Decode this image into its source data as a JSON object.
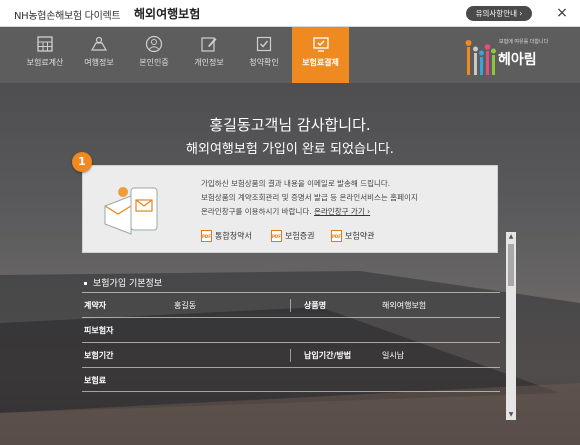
{
  "titlebar": {
    "brand": "NH농협손해보험 다이렉트",
    "title": "해외여행보험",
    "notice_button": "유의사항안내 ›",
    "close": "×"
  },
  "nav": {
    "tabs": [
      {
        "label": "보험료계산",
        "icon": "calculator-icon",
        "active": false
      },
      {
        "label": "여행정보",
        "icon": "map-icon",
        "active": false
      },
      {
        "label": "본인인증",
        "icon": "user-icon",
        "active": false
      },
      {
        "label": "개인정보",
        "icon": "edit-icon",
        "active": false
      },
      {
        "label": "청약확인",
        "icon": "checkbox-icon",
        "active": false
      },
      {
        "label": "보험료결제",
        "icon": "payment-icon",
        "active": true
      }
    ],
    "logo_sub": "보험에 여유를 더합니다",
    "logo": "헤아림"
  },
  "thanks": {
    "line1": "홍길동고객님 감사합니다.",
    "line2": "해외여행보험 가입이 완료 되었습니다."
  },
  "infobox": {
    "badge": "1",
    "line1": "가입하신 보험상품의 결과 내용을 이메일로 발송해 드립니다.",
    "line2": "보험상품의 계약조회관리 및 증명서 발급 등 온라인서비스는 홈페이지",
    "line3": "온라인창구를 이용하시기 바랍니다.",
    "link": "온라인창구 가기 ›",
    "docs": [
      "통합청약서",
      "보험증권",
      "보험약관"
    ],
    "pdf_label": "PDF"
  },
  "basic_info": {
    "title": "보험가입 기본정보",
    "rows": [
      {
        "h1": "계약자",
        "v1": "홍길동",
        "h2": "상품명",
        "v2": "해외여행보험"
      },
      {
        "h1": "피보험자",
        "v1": "",
        "h2": "",
        "v2": ""
      },
      {
        "h1": "보험기간",
        "v1": "",
        "h2": "납입기간/방법",
        "v2": "일시납"
      },
      {
        "h1": "보험료",
        "v1": "",
        "h2": "",
        "v2": ""
      }
    ]
  },
  "colors": {
    "accent": "#ef8a21",
    "nav_bg": "#5d5d5d"
  }
}
